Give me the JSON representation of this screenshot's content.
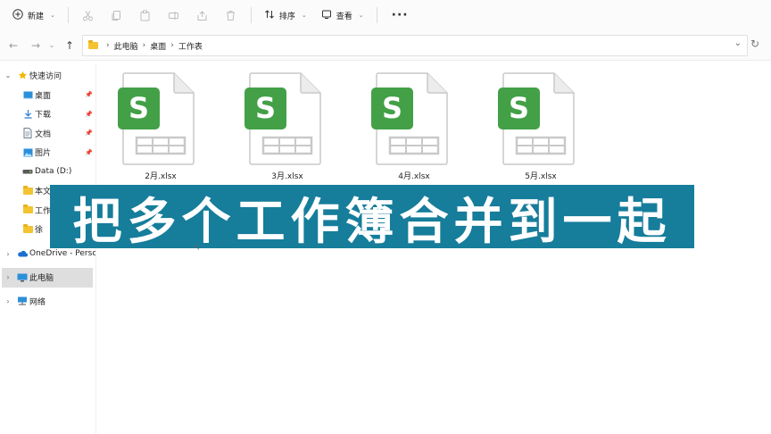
{
  "toolbar": {
    "new_label": "新建",
    "sort_label": "排序",
    "view_label": "查看",
    "more_label": "···"
  },
  "address": {
    "crumbs": [
      "此电脑",
      "桌面",
      "工作表"
    ]
  },
  "sidebar": {
    "items": [
      {
        "label": "快速访问",
        "icon": "star-icon"
      },
      {
        "label": "桌面",
        "icon": "desktop-icon",
        "pinned": true
      },
      {
        "label": "下载",
        "icon": "download-icon",
        "pinned": true
      },
      {
        "label": "文档",
        "icon": "document-icon",
        "pinned": true
      },
      {
        "label": "图片",
        "icon": "picture-icon",
        "pinned": true
      },
      {
        "label": "Data (D:)",
        "icon": "drive-icon"
      },
      {
        "label": "本文",
        "icon": "folder-icon"
      },
      {
        "label": "工作",
        "icon": "folder-icon"
      },
      {
        "label": "徐",
        "icon": "folder-icon"
      },
      {
        "label": "OneDrive - Persona",
        "icon": "cloud-icon"
      },
      {
        "label": "此电脑",
        "icon": "computer-icon",
        "selected": true
      },
      {
        "label": "网络",
        "icon": "network-icon"
      }
    ]
  },
  "files": [
    {
      "name": "2月.xlsx",
      "icon": "wps-spreadsheet-icon"
    },
    {
      "name": "3月.xlsx",
      "icon": "wps-spreadsheet-icon"
    },
    {
      "name": "4月.xlsx",
      "icon": "wps-spreadsheet-icon"
    },
    {
      "name": "5月.xlsx",
      "icon": "wps-spreadsheet-icon"
    }
  ],
  "banner": {
    "text": "把多个工作簿合并到一起"
  },
  "colors": {
    "banner_bg": "#167d9b",
    "wps_green": "#43a047",
    "folder_yellow": "#f4c430",
    "selected_bg": "#dedede"
  }
}
